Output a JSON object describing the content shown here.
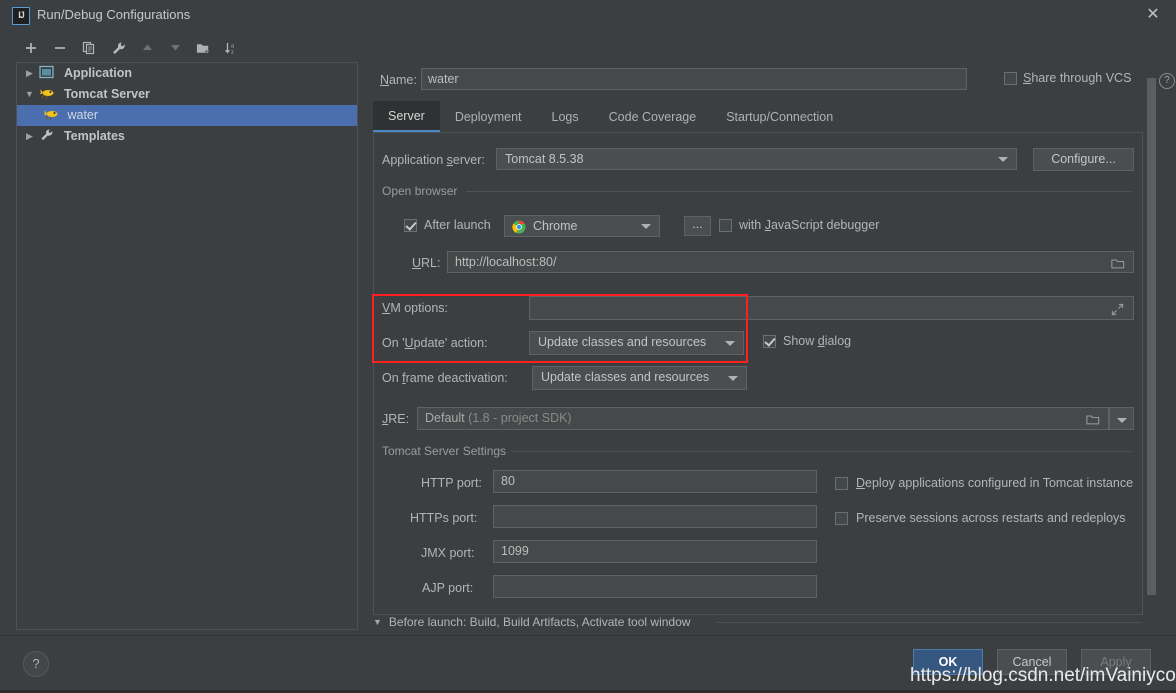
{
  "window": {
    "title": "Run/Debug Configurations",
    "app_icon": "IJ",
    "close_icon": "close-icon"
  },
  "sidebar": {
    "toolbar": [
      {
        "name": "add-button",
        "icon": "plus-icon"
      },
      {
        "name": "remove-button",
        "icon": "minus-icon"
      },
      {
        "name": "copy-button",
        "icon": "copy-icon"
      },
      {
        "name": "edit-templates-button",
        "icon": "wrench-icon"
      },
      {
        "name": "move-up-button",
        "icon": "arrow-up-icon"
      },
      {
        "name": "move-down-button",
        "icon": "arrow-down-icon"
      },
      {
        "name": "new-folder-button",
        "icon": "folder-add-icon"
      },
      {
        "name": "sort-button",
        "icon": "sort-alpha-icon"
      }
    ],
    "tree": [
      {
        "label": "Application",
        "icon": "application-icon",
        "arrow": "▶",
        "level": 0,
        "selected": false
      },
      {
        "label": "Tomcat Server",
        "icon": "tomcat-icon",
        "arrow": "▼",
        "level": 0,
        "selected": false
      },
      {
        "label": "water",
        "icon": "tomcat-icon",
        "arrow": "",
        "level": 1,
        "selected": true
      },
      {
        "label": "Templates",
        "icon": "wrench-icon",
        "arrow": "▶",
        "level": 0,
        "selected": false
      }
    ]
  },
  "header": {
    "name_label": "Name:",
    "name_value": "water",
    "share_label": "Share through VCS",
    "share_checked": false,
    "help_icon": "question-icon"
  },
  "tabs": [
    {
      "label": "Server",
      "active": true
    },
    {
      "label": "Deployment",
      "active": false
    },
    {
      "label": "Logs",
      "active": false
    },
    {
      "label": "Code Coverage",
      "active": false
    },
    {
      "label": "Startup/Connection",
      "active": false
    }
  ],
  "server_tab": {
    "application_server": {
      "label": "Application server:",
      "value": "Tomcat 8.5.38",
      "configure_button": "Configure..."
    },
    "open_browser": {
      "caption": "Open browser",
      "after_launch_label": "After launch",
      "after_launch_checked": true,
      "browser_value": "Chrome",
      "browser_icon": "chrome-icon",
      "ellipsis_button": "...",
      "js_debugger_label": "with JavaScript debugger",
      "js_debugger_checked": false,
      "url_label": "URL:",
      "url_value": "http://localhost:80/",
      "url_browse_icon": "folder-icon"
    },
    "vm_options": {
      "label": "VM options:",
      "value": "",
      "expand_icon": "expand-icon"
    },
    "update_action": {
      "label": "On 'Update' action:",
      "value": "Update classes and resources",
      "show_dialog_label": "Show dialog",
      "show_dialog_checked": true
    },
    "frame_deactivation": {
      "label": "On frame deactivation:",
      "value": "Update classes and resources"
    },
    "jre": {
      "label": "JRE:",
      "value": "Default",
      "value_dim": "(1.8 - project SDK)",
      "browse_icon": "folder-icon",
      "dropdown_icon": "chevron-down-icon"
    },
    "tomcat_settings": {
      "caption": "Tomcat Server Settings",
      "ports": [
        {
          "label": "HTTP port:",
          "value": "80"
        },
        {
          "label": "HTTPs port:",
          "value": ""
        },
        {
          "label": "JMX port:",
          "value": "1099"
        },
        {
          "label": "AJP port:",
          "value": ""
        }
      ],
      "options": [
        {
          "label": "Deploy applications configured in Tomcat instance",
          "checked": false
        },
        {
          "label": "Preserve sessions across restarts and redeploys",
          "checked": false
        }
      ]
    }
  },
  "before_launch": {
    "arrow": "▼",
    "text": "Before launch: Build, Build Artifacts, Activate tool window"
  },
  "footer": {
    "help_icon": "question-icon",
    "ok": "OK",
    "cancel": "Cancel",
    "apply": "Apply"
  },
  "watermark": "https://blog.csdn.net/imVainiycos",
  "colors": {
    "background": "#3c3f41",
    "selection": "#4b6eaf",
    "accent_tab": "#4a88c7",
    "primary_button": "#365880",
    "highlight_box": "#ff1f1f"
  }
}
